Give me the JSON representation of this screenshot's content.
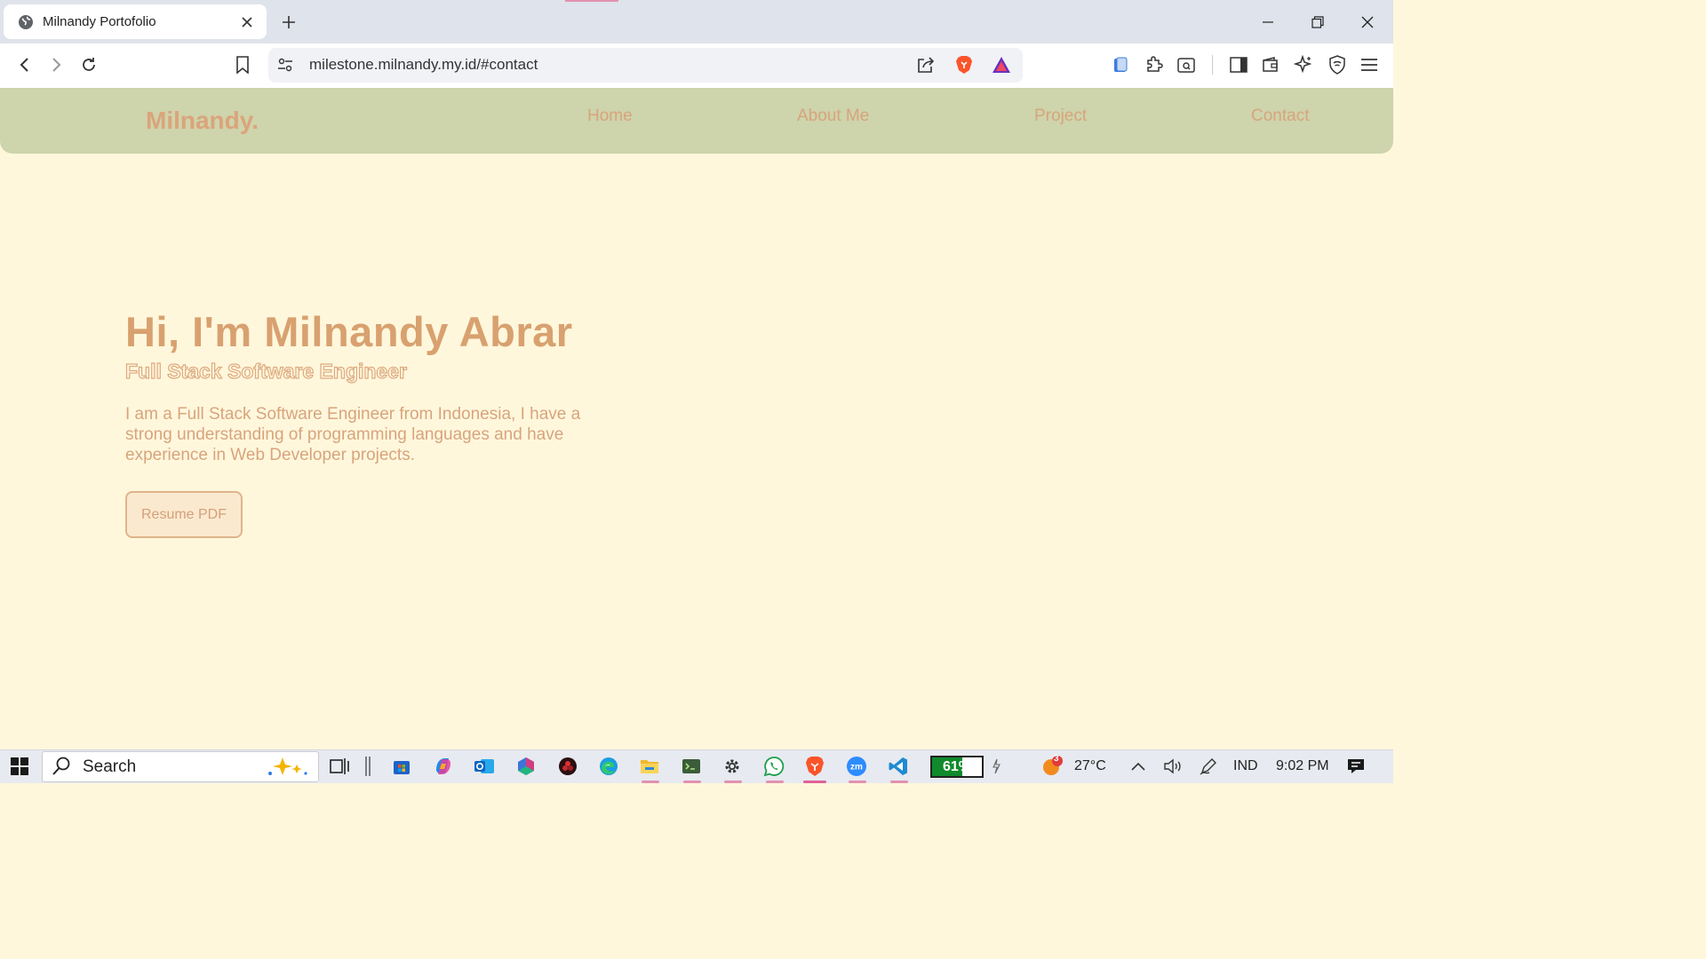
{
  "browser": {
    "tab_title": "Milnandy Portofolio",
    "url": "milestone.milnandy.my.id/#contact"
  },
  "page": {
    "brand": "Milnandy.",
    "nav": [
      "Home",
      "About Me",
      "Project",
      "Contact"
    ],
    "hero_title": "Hi, I'm Milnandy Abrar",
    "hero_subtitle": "Full Stack Software Engineer",
    "hero_description": "I am a Full Stack Software Engineer from Indonesia, I have a strong understanding of programming languages and have experience in Web Developer projects.",
    "resume_button": "Resume PDF"
  },
  "taskbar": {
    "search_label": "Search",
    "battery": "61%",
    "battery_level": 0.61,
    "weather_badge": "3",
    "temperature": "27°C",
    "language": "IND",
    "time": "9:02 PM"
  },
  "colors": {
    "page_bg": "#fff7dc",
    "nav_bg": "#ced4ab",
    "accent": "#d8a47d"
  }
}
